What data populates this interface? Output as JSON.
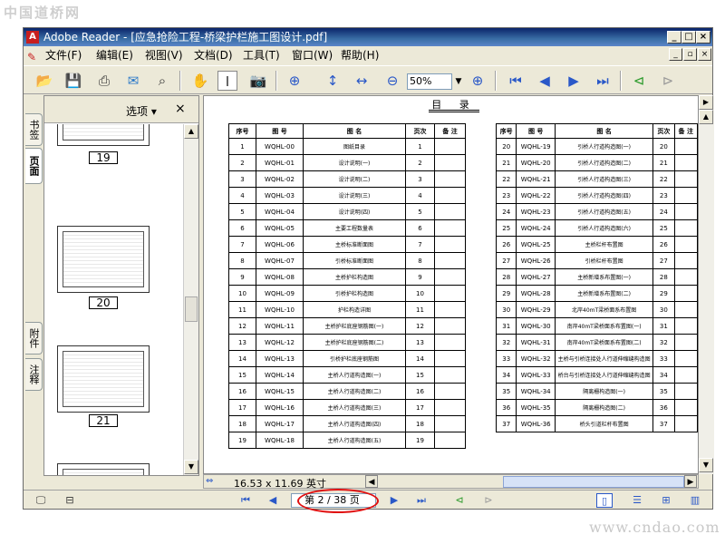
{
  "watermarks": {
    "top": "中国道桥网",
    "bottom": "www.cndao.com"
  },
  "window": {
    "title": "Adobe Reader - [应急抢险工程-桥梁护栏施工图设计.pdf]",
    "buttons": [
      "_",
      "□",
      "×"
    ],
    "doc_buttons": [
      "_",
      "▫",
      "×"
    ]
  },
  "menu": [
    "文件(F)",
    "编辑(E)",
    "视图(V)",
    "文档(D)",
    "工具(T)",
    "窗口(W)",
    "帮助(H)"
  ],
  "toolbar": {
    "zoom": "50%"
  },
  "sidetabs": [
    "书签",
    "页面",
    "附件",
    "注释"
  ],
  "panel": {
    "options_label": "选项 ▾",
    "close": "×",
    "thumb_pages": [
      "19",
      "20",
      "21"
    ]
  },
  "document": {
    "title": "目 录",
    "headers": [
      "序号",
      "图 号",
      "图 名",
      "页次",
      "备 注"
    ],
    "rows_left": [
      [
        "1",
        "WQHL-00",
        "图纸目录",
        "1"
      ],
      [
        "2",
        "WQHL-01",
        "设计说明(一)",
        "2"
      ],
      [
        "3",
        "WQHL-02",
        "设计说明(二)",
        "3"
      ],
      [
        "4",
        "WQHL-03",
        "设计说明(三)",
        "4"
      ],
      [
        "5",
        "WQHL-04",
        "设计说明(四)",
        "5"
      ],
      [
        "6",
        "WQHL-05",
        "主要工程数量表",
        "6"
      ],
      [
        "7",
        "WQHL-06",
        "主桥标准断面图",
        "7"
      ],
      [
        "8",
        "WQHL-07",
        "引桥标准断面图",
        "8"
      ],
      [
        "9",
        "WQHL-08",
        "主桥护栏构造图",
        "9"
      ],
      [
        "10",
        "WQHL-09",
        "引桥护栏构造图",
        "10"
      ],
      [
        "11",
        "WQHL-10",
        "护栏构造详图",
        "11"
      ],
      [
        "12",
        "WQHL-11",
        "主桥护栏底座钢筋图(一)",
        "12"
      ],
      [
        "13",
        "WQHL-12",
        "主桥护栏底座钢筋图(二)",
        "13"
      ],
      [
        "14",
        "WQHL-13",
        "引桥护栏底座钢筋图",
        "14"
      ],
      [
        "15",
        "WQHL-14",
        "主桥人行道构造图(一)",
        "15"
      ],
      [
        "16",
        "WQHL-15",
        "主桥人行道构造图(二)",
        "16"
      ],
      [
        "17",
        "WQHL-16",
        "主桥人行道构造图(三)",
        "17"
      ],
      [
        "18",
        "WQHL-17",
        "主桥人行道构造图(四)",
        "18"
      ],
      [
        "19",
        "WQHL-18",
        "主桥人行道构造图(五)",
        "19"
      ]
    ],
    "rows_right": [
      [
        "20",
        "WQHL-19",
        "引桥人行道构造图(一)",
        "20"
      ],
      [
        "21",
        "WQHL-20",
        "引桥人行道构造图(二)",
        "21"
      ],
      [
        "22",
        "WQHL-21",
        "引桥人行道构造图(三)",
        "22"
      ],
      [
        "23",
        "WQHL-22",
        "引桥人行道构造图(四)",
        "23"
      ],
      [
        "24",
        "WQHL-23",
        "引桥人行道构造图(五)",
        "24"
      ],
      [
        "25",
        "WQHL-24",
        "引桥人行道构造图(六)",
        "25"
      ],
      [
        "26",
        "WQHL-25",
        "主桥栏杆布置图",
        "26"
      ],
      [
        "27",
        "WQHL-26",
        "引桥栏杆布置图",
        "27"
      ],
      [
        "28",
        "WQHL-27",
        "主桥新增系布置图(一)",
        "28"
      ],
      [
        "29",
        "WQHL-28",
        "主桥新增系布置图(二)",
        "29"
      ],
      [
        "30",
        "WQHL-29",
        "北岸40mT梁桥面系布置图",
        "30"
      ],
      [
        "31",
        "WQHL-30",
        "南岸40mT梁桥面系布置图(一)",
        "31"
      ],
      [
        "32",
        "WQHL-31",
        "南岸40mT梁桥面系布置图(二)",
        "32"
      ],
      [
        "33",
        "WQHL-32",
        "主桥与引桥连接处人行道伸缩缝构造图",
        "33"
      ],
      [
        "34",
        "WQHL-33",
        "桥台与引桥连接处人行道伸缩缝构造图",
        "34"
      ],
      [
        "35",
        "WQHL-34",
        "隔离栅构造图(一)",
        "35"
      ],
      [
        "36",
        "WQHL-35",
        "隔离栅构造图(二)",
        "36"
      ],
      [
        "37",
        "WQHL-36",
        "桥头引道栏杆布置图",
        "37"
      ]
    ]
  },
  "status": {
    "page_size": "16.53 x 11.69 英寸",
    "page_indicator": "第 2 / 38 页"
  },
  "colors": {
    "title_bar": "#0a246a",
    "highlight": "#e01010",
    "chrome": "#ece9d8"
  }
}
